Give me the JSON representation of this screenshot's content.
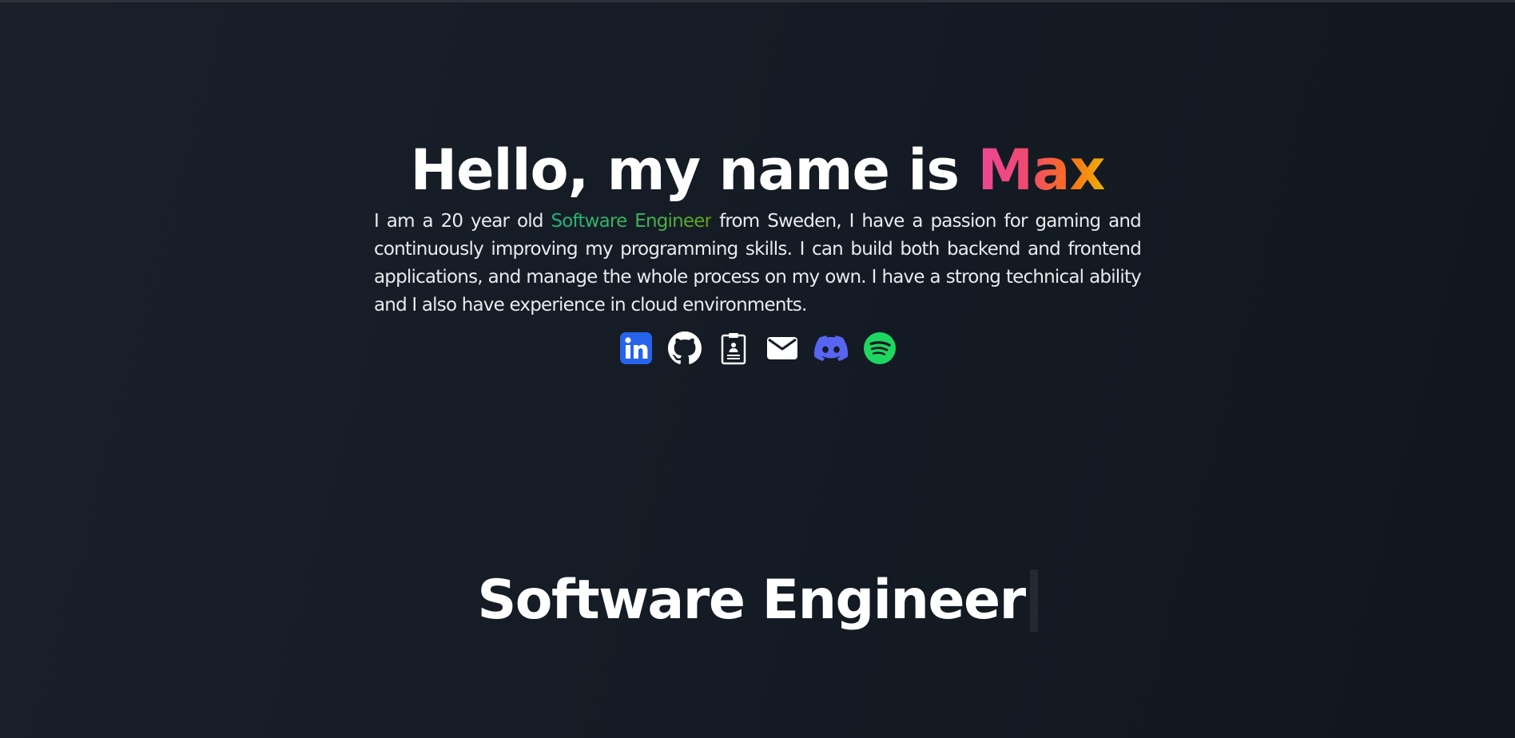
{
  "hero": {
    "greeting": "Hello, my name is ",
    "name": "Max",
    "intro_before": "I am a 20 year old ",
    "intro_role": "Software Engineer",
    "intro_after": " from Sweden, I have a passion for gaming and continuously improving my programming skills. I can build both backend and frontend applications, and manage the whole process on my own. I have a strong technical ability and I also have experience in cloud environments."
  },
  "socials": [
    {
      "icon": "linkedin-icon",
      "color": "#2563eb"
    },
    {
      "icon": "github-icon",
      "color": "#ffffff"
    },
    {
      "icon": "resume-icon",
      "color": "#ffffff"
    },
    {
      "icon": "mail-icon",
      "color": "#ffffff"
    },
    {
      "icon": "discord-icon",
      "color": "#5865f2"
    },
    {
      "icon": "spotify-icon",
      "color": "#1ed760"
    }
  ],
  "typed": {
    "text": "Software Engineer"
  },
  "colors": {
    "name_gradient": [
      "#ec4899",
      "#f97316",
      "#eab308"
    ],
    "role_gradient": [
      "#22b07d",
      "#65a30d"
    ],
    "background": "#161b24"
  }
}
